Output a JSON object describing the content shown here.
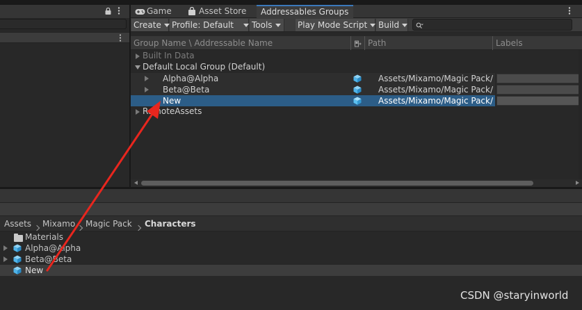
{
  "tabs": [
    {
      "label": "Game",
      "icon": "gamepad-icon"
    },
    {
      "label": "Asset Store",
      "icon": "shopping-bag-icon"
    },
    {
      "label": "Addressables Groups",
      "active": true
    }
  ],
  "toolbar": {
    "create": "Create",
    "profile": "Profile: Default",
    "tools": "Tools",
    "play_mode": "Play Mode Script",
    "build": "Build"
  },
  "columns": {
    "name": "Group Name \\ Addressable Name",
    "path": "Path",
    "labels": "Labels"
  },
  "groups": {
    "built_in": "Built In Data",
    "default_local": "Default Local Group (Default)",
    "remote": "RemoteAssets"
  },
  "entries": [
    {
      "name": "Alpha@Alpha",
      "path": "Assets/Mixamo/Magic Pack/"
    },
    {
      "name": "Beta@Beta",
      "path": "Assets/Mixamo/Magic Pack/"
    },
    {
      "name": "New",
      "path": "Assets/Mixamo/Magic Pack/",
      "selected": true
    }
  ],
  "breadcrumb": [
    "Assets",
    "Mixamo",
    "Magic Pack",
    "Characters"
  ],
  "project_items": [
    "Materials",
    "Alpha@Alpha",
    "Beta@Beta",
    "New"
  ],
  "watermark": "CSDN @staryinworld",
  "colors": {
    "accent": "#3a79bb",
    "selection": "#2c5d87",
    "arrow": "#e8261e",
    "prefab": "#4fb3e8"
  }
}
